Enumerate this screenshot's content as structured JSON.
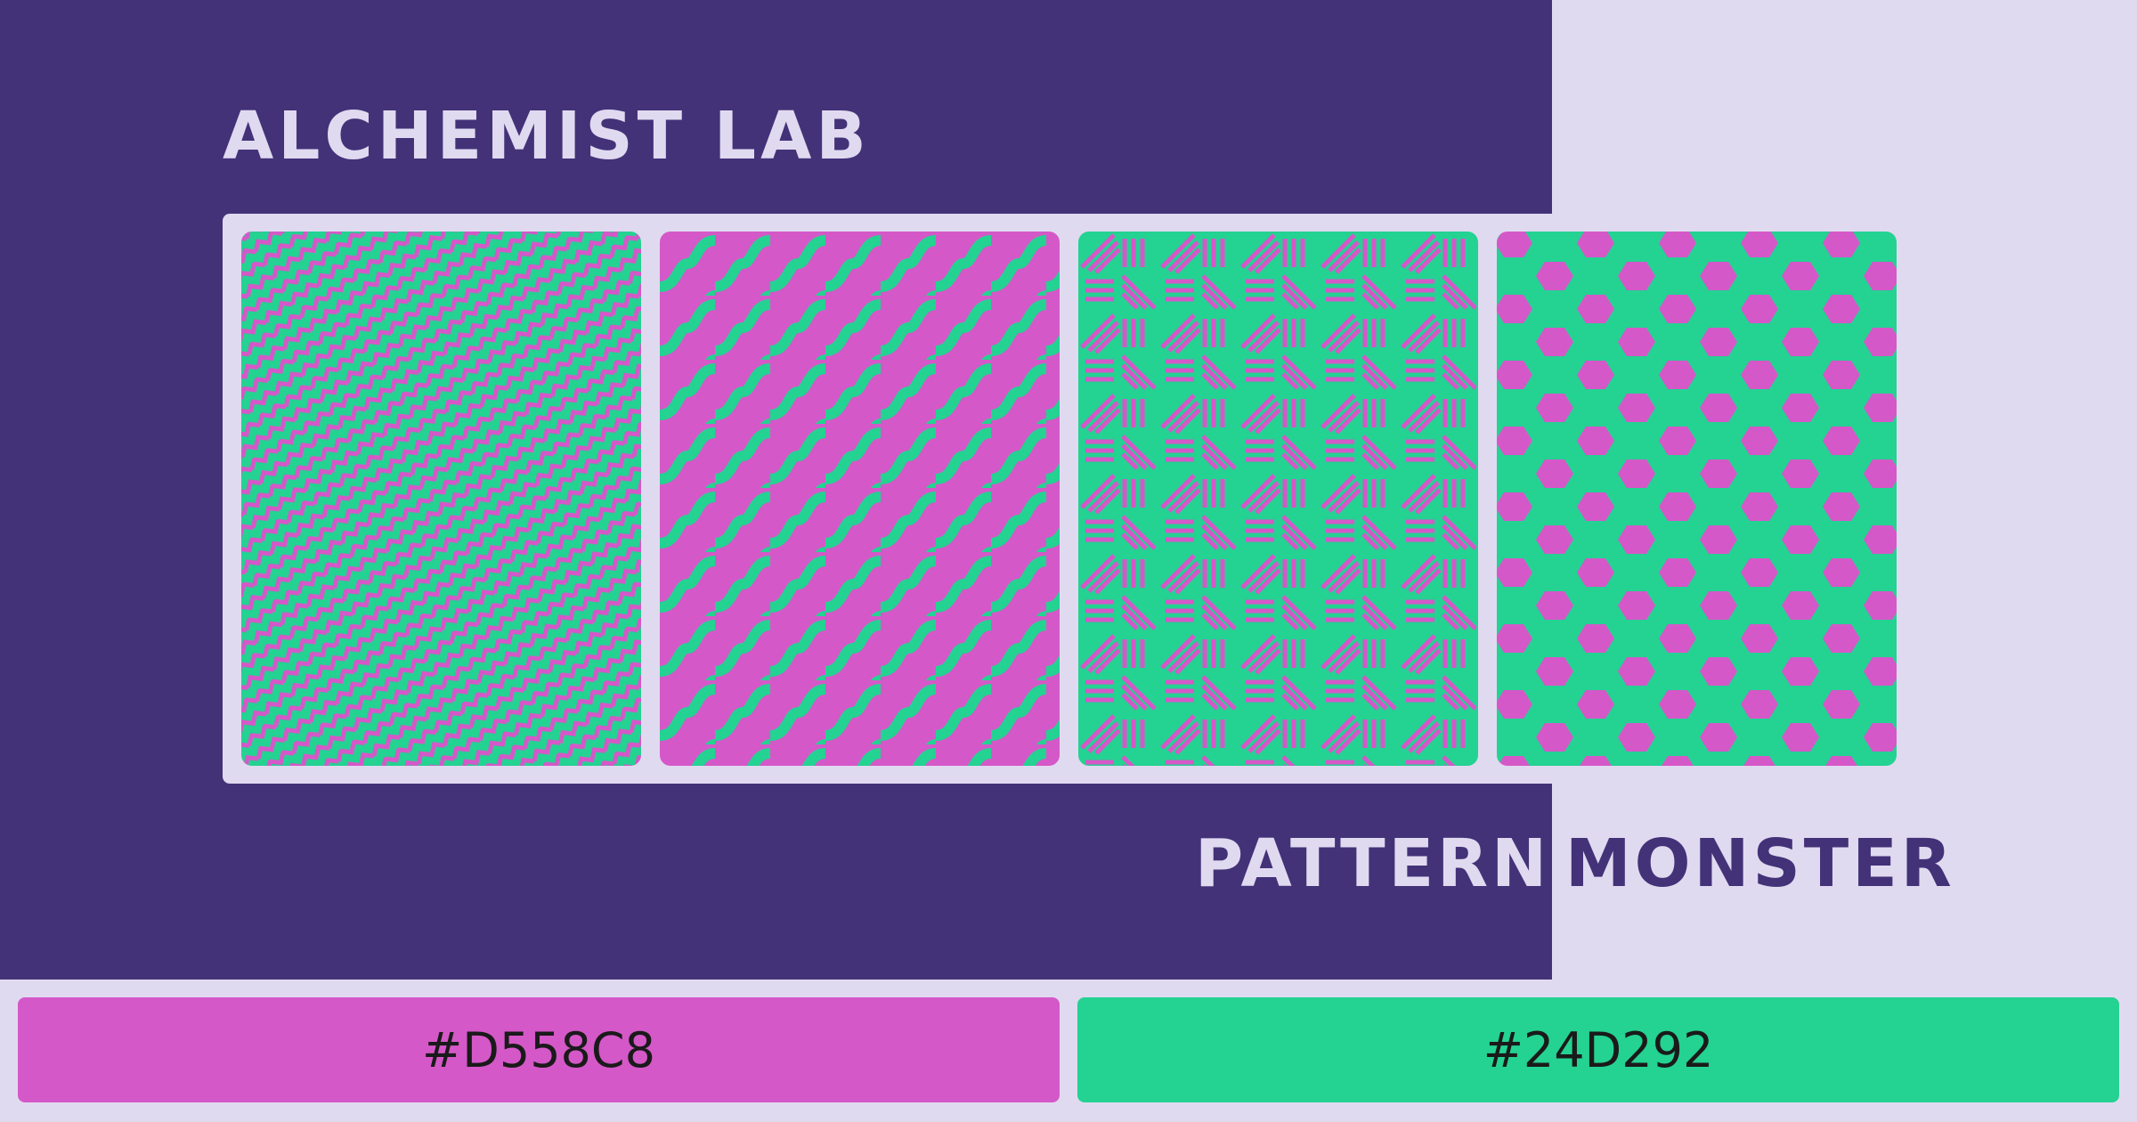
{
  "header": {
    "title": "ALCHEMIST  LAB"
  },
  "brand": {
    "first": "PATTERN",
    "second": "MONSTER"
  },
  "colors": {
    "magenta": "#D558C8",
    "green": "#24D292",
    "dark_purple": "#433278",
    "lavender": "#E0DAF0"
  },
  "patterns": [
    {
      "name": "chevron-weave-pattern",
      "background": "#24D292",
      "stroke": "#D558C8"
    },
    {
      "name": "wave-pattern",
      "background": "#D558C8",
      "stroke": "#24D292"
    },
    {
      "name": "diagonal-lines-pattern",
      "background": "#24D292",
      "stroke": "#D558C8"
    },
    {
      "name": "hexagon-pattern",
      "background": "#D558C8",
      "stroke": "#24D292"
    }
  ],
  "swatches": [
    {
      "label": "#D558C8",
      "color": "#D558C8"
    },
    {
      "label": "#24D292",
      "color": "#24D292"
    }
  ]
}
